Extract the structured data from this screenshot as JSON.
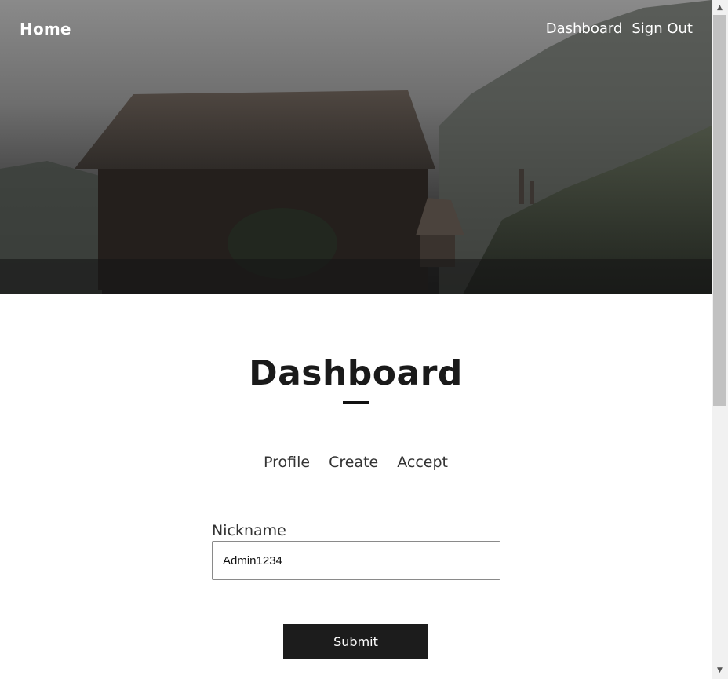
{
  "nav": {
    "home_label": "Home",
    "links": [
      {
        "label": "Dashboard"
      },
      {
        "label": "Sign Out"
      }
    ]
  },
  "main": {
    "title": "Dashboard",
    "tabs": [
      {
        "label": "Profile"
      },
      {
        "label": "Create"
      },
      {
        "label": "Accept"
      }
    ],
    "form": {
      "nickname_label": "Nickname",
      "nickname_value": "Admin1234",
      "submit_label": "Submit"
    }
  },
  "colors": {
    "title": "#1a1a1a",
    "button_bg": "#1c1c1c",
    "hero_overlay": "#2a2a2a"
  }
}
